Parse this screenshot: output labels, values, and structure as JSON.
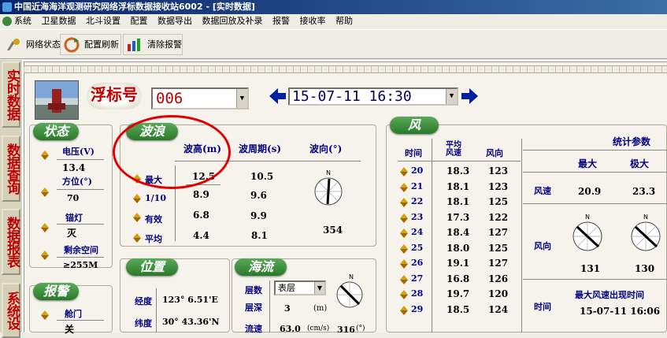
{
  "window": {
    "title": "中国近海海洋观测研究网络浮标数据接收站6002 - [实时数据]"
  },
  "menu": [
    "系统",
    "卫星数据",
    "北斗设置",
    "配置",
    "数据导出",
    "数据回放及补录",
    "报警",
    "接收率",
    "帮助"
  ],
  "toolbar": {
    "network": "网络状态",
    "refresh": "配置刷新",
    "clear": "清除报警"
  },
  "sidenav": [
    "实时数据",
    "数据查询",
    "数据报表",
    "系统设"
  ],
  "buoy": {
    "label": "浮标号",
    "id": "006",
    "datetime": "15-07-11  16:30"
  },
  "status": {
    "title": "状态",
    "voltage_label": "电压(V)",
    "voltage": "13.4",
    "heading_label": "方位(°)",
    "heading": "70",
    "lamp_label": "锚灯",
    "lamp": "灭",
    "space_label": "剩余空间",
    "space": "≥255M"
  },
  "alarm": {
    "title": "报警",
    "door_label": "舱门",
    "door": "关"
  },
  "wave": {
    "title": "波浪",
    "headers": [
      "波高(m)",
      "波周期(s)",
      "波向(°)"
    ],
    "rows": [
      {
        "name": "最大",
        "height": "12.5",
        "period": "10.5"
      },
      {
        "name": "1/10",
        "height": "8.9",
        "period": "9.6"
      },
      {
        "name": "有效",
        "height": "6.8",
        "period": "9.9"
      },
      {
        "name": "平均",
        "height": "4.4",
        "period": "8.1"
      }
    ],
    "direction": "354"
  },
  "position": {
    "title": "位置",
    "lon_label": "经度",
    "lon": "123° 6.51'E",
    "lat_label": "纬度",
    "lat": "30° 43.36'N"
  },
  "current": {
    "title": "海流",
    "layer_label": "层数",
    "layer": "表层",
    "depth_label": "层深",
    "depth": "3",
    "depth_unit": "(m)",
    "speed_label": "流速",
    "speed": "63.0",
    "speed_unit": "(cm/s)",
    "dir": "316",
    "dir_unit": "(°)"
  },
  "wind": {
    "title": "风",
    "col_time": "时间",
    "col_avg": "平均风速",
    "col_dir": "风向",
    "rows": [
      {
        "time": "20",
        "speed": "18.3",
        "dir": "123"
      },
      {
        "time": "21",
        "speed": "18.1",
        "dir": "123"
      },
      {
        "time": "22",
        "speed": "18.1",
        "dir": "125"
      },
      {
        "time": "23",
        "speed": "17.3",
        "dir": "122"
      },
      {
        "time": "24",
        "speed": "18.4",
        "dir": "127"
      },
      {
        "time": "25",
        "speed": "18.0",
        "dir": "125"
      },
      {
        "time": "26",
        "speed": "19.1",
        "dir": "127"
      },
      {
        "time": "27",
        "speed": "16.8",
        "dir": "126"
      },
      {
        "time": "28",
        "speed": "19.7",
        "dir": "120"
      },
      {
        "time": "29",
        "speed": "18.5",
        "dir": "124"
      }
    ],
    "stats": {
      "title": "统计参数",
      "max": "最大",
      "extreme": "极大",
      "speed_label": "风速",
      "speed_max": "20.9",
      "speed_extreme": "23.3",
      "dir_label": "风向",
      "dir_max": "131",
      "dir_extreme": "130",
      "time_label": "时间",
      "time_title": "最大风速出现时间",
      "time_value": "15-07-11 16:06"
    }
  },
  "compass_letter": "N",
  "colors": {
    "accent_red": "#c00000",
    "pill_green": "#2a7a2a",
    "label_blue": "#000080"
  }
}
